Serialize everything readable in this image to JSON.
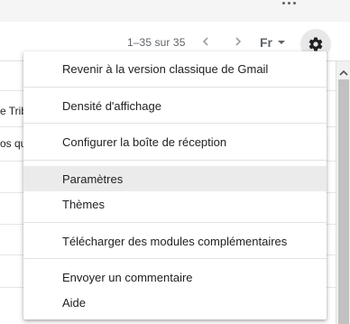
{
  "toolbar": {
    "pagination": "1–35 sur 35",
    "language": "Fr"
  },
  "list": {
    "fragments": [
      "e Trib",
      "os qu"
    ]
  },
  "menu": {
    "items": [
      "Revenir à la version classique de Gmail",
      "Densité d'affichage",
      "Configurer la boîte de réception",
      "Paramètres",
      "Thèmes",
      "Télécharger des modules complémentaires",
      "Envoyer un commentaire",
      "Aide"
    ],
    "highlighted_item": "Paramètres"
  },
  "colors": {
    "menu_highlight": "#ebebeb",
    "icon_gray": "#5f6368",
    "gear_bg": "#e8e8e8"
  }
}
